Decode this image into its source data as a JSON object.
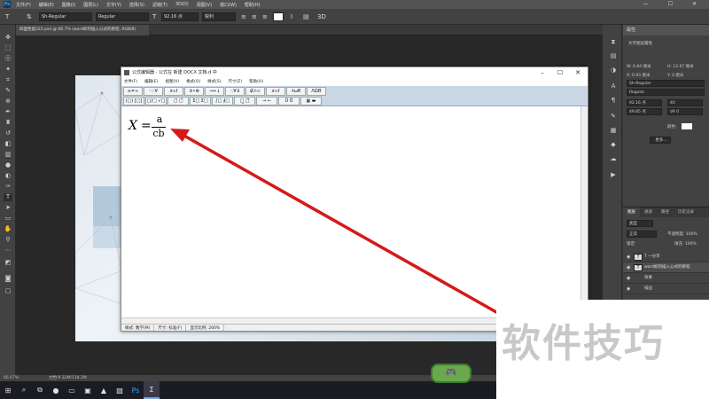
{
  "ps": {
    "logo": "Ps",
    "menu": [
      "文件(F)",
      "编辑(E)",
      "图像(I)",
      "图层(L)",
      "文字(Y)",
      "选择(S)",
      "滤镜(T)",
      "3D(D)",
      "视图(V)",
      "窗口(W)",
      "帮助(H)"
    ],
    "window_controls": "— ☐ ✕",
    "options": {
      "font_family": "Sh-Regular",
      "font_style": "Regular",
      "font_size": "92.16 点",
      "antialias": "锐利",
      "mode_3d": "3D"
    },
    "doc_tab": "四面性能222.psd @ 66.7% (word如何插入公式的教程, RGB/8)",
    "status_zoom": "66.67%",
    "status_doc": "文档:9.32M/118.2M"
  },
  "props_panel": {
    "title": "属性",
    "layer_kind": "文字图层属性",
    "w": "W: 6.84 厘米",
    "h": "H: 12.67 厘米",
    "x": "X: 0.93 厘米",
    "y": "Y: 0 厘米",
    "font_family": "Sh-Regular",
    "font_style": "Regular",
    "font_size": "92.16 点",
    "leading": "40",
    "tracking": "VA 0",
    "scale": "49.85 点",
    "color_label": "颜色:",
    "more_btn": "更多..."
  },
  "layers_panel": {
    "tabs": [
      "图层",
      "通道",
      "路径",
      "历史记录"
    ],
    "filter_kind": "类型",
    "blend": "正常",
    "opacity": "不透明度: 100%",
    "lock": "锁定:",
    "fill": "填充: 100%",
    "rows": [
      {
        "name": "T  一分享",
        "thumb": "T"
      },
      {
        "name": "word如何插入公式的教程",
        "thumb": "T"
      },
      {
        "name": "效果",
        "thumb": ""
      },
      {
        "name": "描边",
        "thumb": ""
      }
    ]
  },
  "equation_editor": {
    "title": "公式编辑器 - 公式在 新建 DOCX 文档.d 中",
    "menu": [
      "文件(F)",
      "编辑(E)",
      "视图(V)",
      "格式(O)",
      "样式(S)",
      "尺寸(Z)",
      "帮助(H)"
    ],
    "palette_row1": [
      "≤≠≈",
      "∵∴∀",
      "∂∞ℓ",
      "±•⊗",
      "→⇔↓",
      "∴∀∃",
      "∉∩⊂",
      "∂∞ℓ",
      "λωθ",
      "ΛΩΘ"
    ],
    "palette_row2": [
      "(□) [□]",
      "□/□ √□",
      "□̄ □̃",
      "Σ□ Σ□",
      "∫□ ∮□",
      "□̲ □̅",
      "→ ←",
      "Ü Ů",
      "▦ ▬"
    ],
    "formula": {
      "lhs": "X",
      "eq": "=",
      "numerator": "a",
      "denominator": "cb"
    },
    "status": [
      "样式: 数学(M)",
      "尺寸: 标准(F)",
      "显示比例: 200%"
    ]
  },
  "watermark": "软件技巧",
  "taskbar": {
    "items": [
      "⊞",
      "⌕",
      "⧉",
      "●",
      "▭",
      "▣",
      "▲",
      "▧",
      "Ps",
      "Σ"
    ]
  }
}
